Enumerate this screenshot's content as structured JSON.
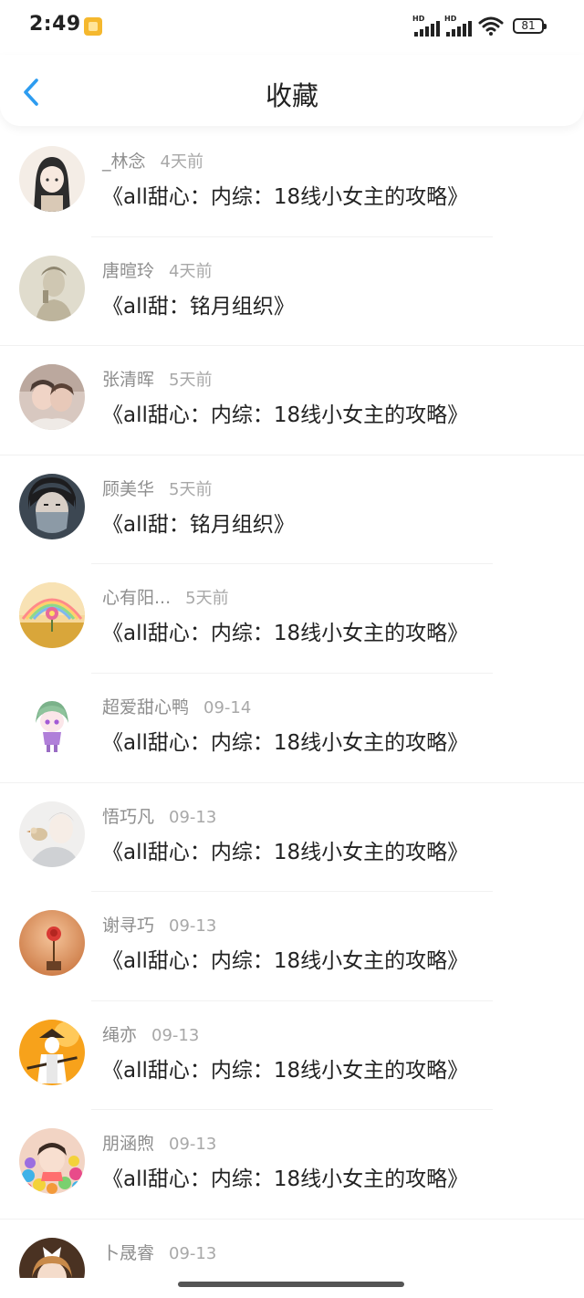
{
  "status": {
    "time": "2:49",
    "battery": "81",
    "signal_labels": [
      "HD",
      "HD"
    ]
  },
  "header": {
    "title": "收藏"
  },
  "items": [
    {
      "user": "_林念",
      "time": "4天前",
      "title": "《all甜心：内综：18线小女主的攻略》",
      "avatar": "girl-portrait-avatar"
    },
    {
      "user": "唐暄玲",
      "time": "4天前",
      "title": "《all甜：铭月组织》",
      "avatar": "sketch-portrait-avatar"
    },
    {
      "user": "张清晖",
      "time": "5天前",
      "title": "《all甜心：内综：18线小女主的攻略》",
      "avatar": "couple-photo-avatar"
    },
    {
      "user": "顾美华",
      "time": "5天前",
      "title": "《all甜：铭月组织》",
      "avatar": "masked-person-avatar"
    },
    {
      "user": "心有阳...",
      "time": "5天前",
      "title": "《all甜心：内综：18线小女主的攻略》",
      "avatar": "rainbow-flower-avatar"
    },
    {
      "user": "超爱甜心鸭",
      "time": "09-14",
      "title": "《all甜心：内综：18线小女主的攻略》",
      "avatar": "chibi-character-avatar"
    },
    {
      "user": "悟巧凡",
      "time": "09-13",
      "title": "《all甜心：内综：18线小女主的攻略》",
      "avatar": "bird-illustration-avatar"
    },
    {
      "user": "谢寻巧",
      "time": "09-13",
      "title": "《all甜心：内综：18线小女主的攻略》",
      "avatar": "rose-avatar"
    },
    {
      "user": "绳亦",
      "time": "09-13",
      "title": "《all甜心：内综：18线小女主的攻略》",
      "avatar": "samurai-illustration-avatar"
    },
    {
      "user": "朋涵煦",
      "time": "09-13",
      "title": "《all甜心：内综：18线小女主的攻略》",
      "avatar": "baby-balls-avatar"
    },
    {
      "user": "卜晟睿",
      "time": "09-13",
      "title": "",
      "avatar": "doll-avatar"
    }
  ],
  "colors": {
    "accent": "#2d9cf0",
    "text_primary": "#222222",
    "text_secondary": "#8e8e8e"
  }
}
